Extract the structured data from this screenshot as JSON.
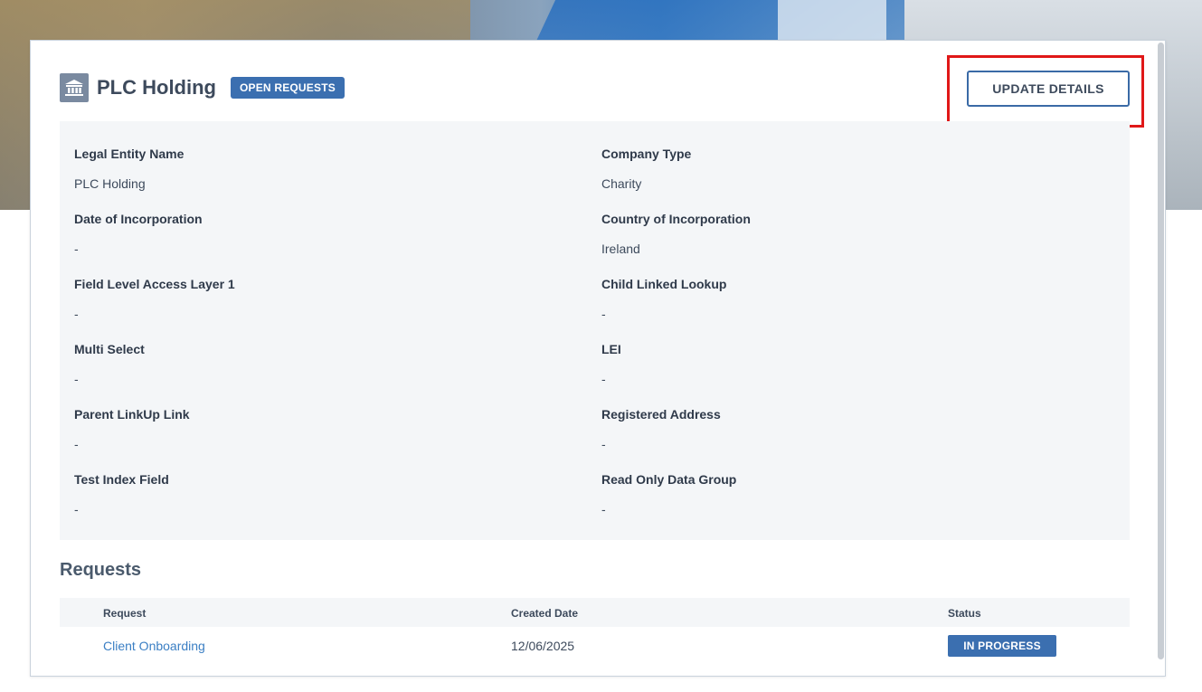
{
  "entity": {
    "title": "PLC Holding",
    "badge": "OPEN REQUESTS",
    "icon": "bank-icon"
  },
  "actions": {
    "update_label": "UPDATE DETAILS"
  },
  "fields": [
    {
      "label": "Legal Entity Name",
      "value": "PLC Holding"
    },
    {
      "label": "Company Type",
      "value": "Charity"
    },
    {
      "label": "Date of Incorporation",
      "value": "-"
    },
    {
      "label": "Country of Incorporation",
      "value": "Ireland"
    },
    {
      "label": "Field Level Access Layer 1",
      "value": "-"
    },
    {
      "label": "Child Linked Lookup",
      "value": "-"
    },
    {
      "label": "Multi Select",
      "value": "-"
    },
    {
      "label": "LEI",
      "value": "-"
    },
    {
      "label": "Parent LinkUp Link",
      "value": "-"
    },
    {
      "label": "Registered Address",
      "value": "-"
    },
    {
      "label": "Test Index Field",
      "value": "-"
    },
    {
      "label": "Read Only Data Group",
      "value": "-"
    }
  ],
  "requests": {
    "title": "Requests",
    "columns": [
      "Request",
      "Created Date",
      "Status"
    ],
    "rows": [
      {
        "request": "Client Onboarding",
        "created": "12/06/2025",
        "status": "IN PROGRESS"
      }
    ]
  },
  "colors": {
    "accent": "#3b6fb0",
    "highlight": "#e01818",
    "link": "#3b7fc4"
  }
}
